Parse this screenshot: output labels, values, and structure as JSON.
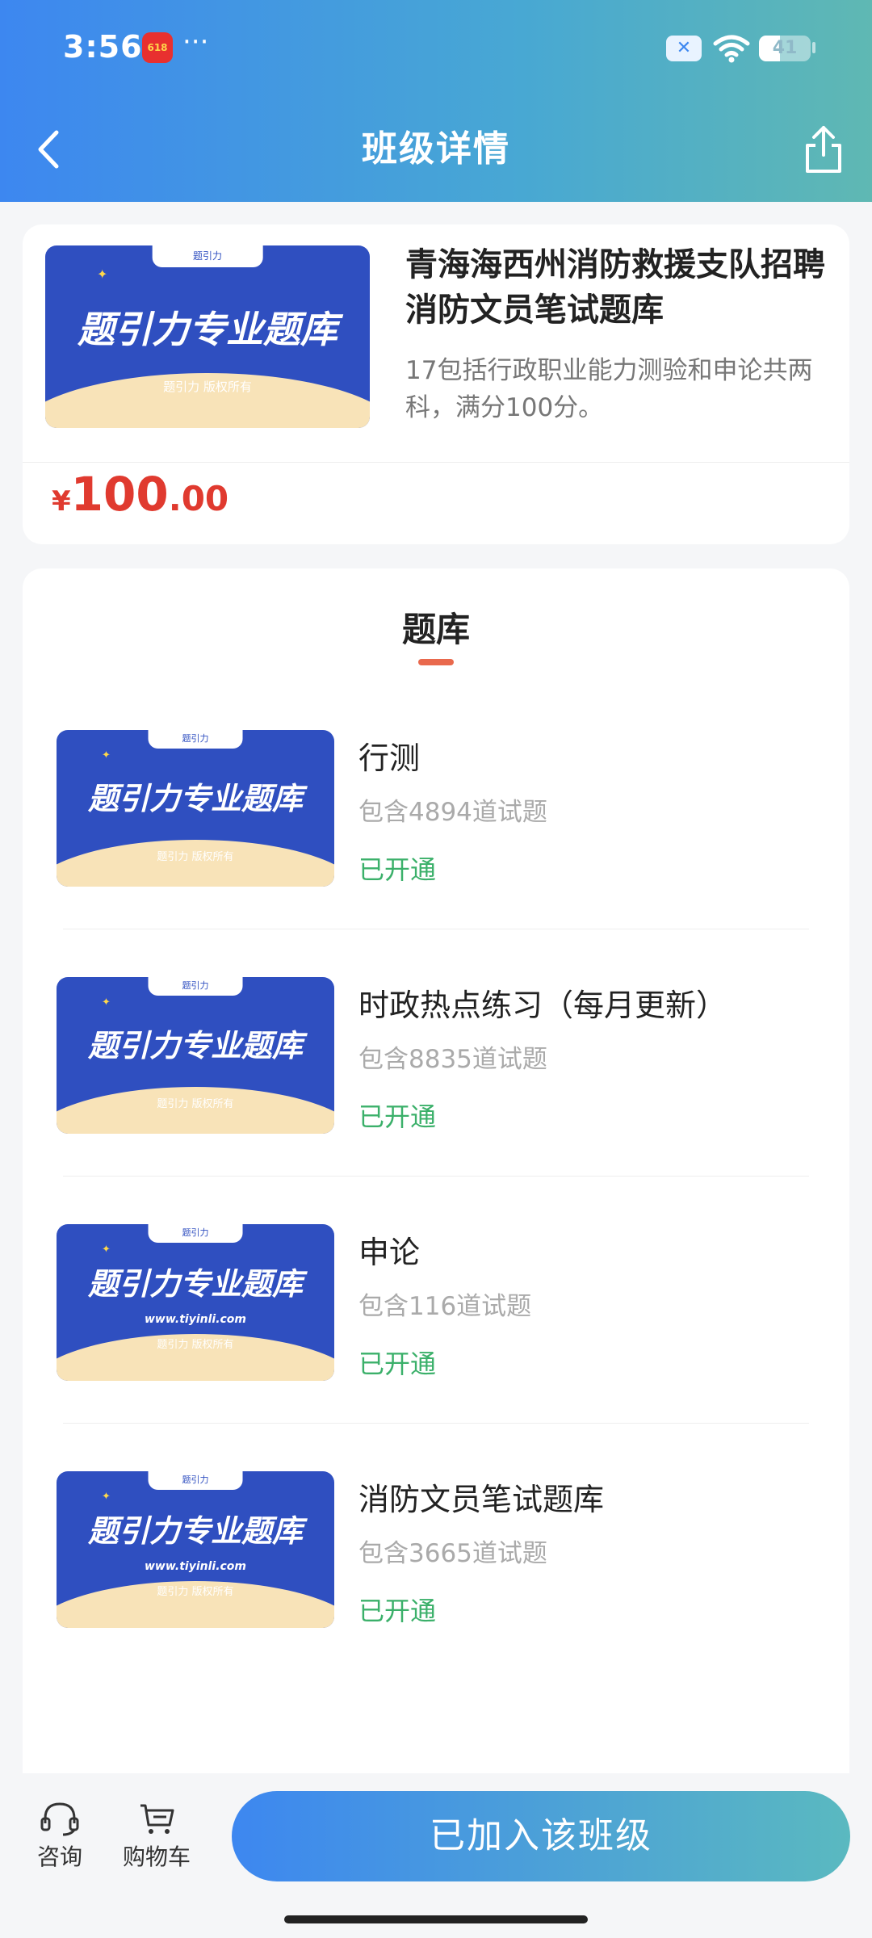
{
  "status_bar": {
    "time": "3:56",
    "app_badge": "618",
    "dots": "···",
    "battery_level": "41",
    "battery_fraction": 0.41
  },
  "nav": {
    "title": "班级详情"
  },
  "course": {
    "thumbnail": {
      "tab": "题引力",
      "title": "题引力专业题库",
      "copyright": "题引力 版权所有"
    },
    "title": "青海海西州消防救援支队招聘消防文员笔试题库",
    "description": "17包括行政职业能力测验和申论共两科，满分100分。",
    "price": {
      "symbol": "¥",
      "integer": "100",
      "decimal": ".00"
    }
  },
  "section": {
    "title": "题库"
  },
  "banks": [
    {
      "thumbnail": {
        "tab": "题引力",
        "title": "题引力专业题库",
        "copyright": "题引力 版权所有",
        "url": ""
      },
      "name": "行测",
      "count": "包含4894道试题",
      "status": "已开通"
    },
    {
      "thumbnail": {
        "tab": "题引力",
        "title": "题引力专业题库",
        "copyright": "题引力 版权所有",
        "url": ""
      },
      "name": "时政热点练习（每月更新）",
      "count": "包含8835道试题",
      "status": "已开通"
    },
    {
      "thumbnail": {
        "tab": "题引力",
        "title": "题引力专业题库",
        "copyright": "题引力 版权所有",
        "url": "www.tiyinli.com"
      },
      "name": "申论",
      "count": "包含116道试题",
      "status": "已开通"
    },
    {
      "thumbnail": {
        "tab": "题引力",
        "title": "题引力专业题库",
        "copyright": "题引力 版权所有",
        "url": "www.tiyinli.com"
      },
      "name": "消防文员笔试题库",
      "count": "包含3665道试题",
      "status": "已开通"
    }
  ],
  "bottom": {
    "consult_label": "咨询",
    "cart_label": "购物车",
    "join_label": "已加入该班级"
  },
  "colors": {
    "accent": "#3d87f0",
    "price": "#e03a2f",
    "status_ok": "#3bb06a",
    "underline": "#e9694d"
  },
  "icons": {
    "back": "chevron-left-icon",
    "share": "share-icon",
    "consult": "headset-icon",
    "cart": "cart-icon",
    "wifi": "wifi-icon",
    "battery": "battery-icon"
  }
}
